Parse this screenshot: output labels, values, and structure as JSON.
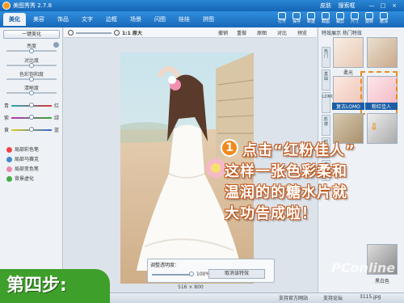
{
  "app": {
    "title": "美图秀秀 2.7.8",
    "window_controls": [
      "皮肤",
      "搜索框",
      "—",
      "□",
      "×"
    ]
  },
  "tabs": [
    "美化",
    "美容",
    "饰品",
    "文字",
    "边框",
    "场景",
    "闪图",
    "娃娃",
    "拼图"
  ],
  "active_tab": "美化",
  "toolbar_right": [
    "打开",
    "保存",
    "新建",
    "截图",
    "裁剪",
    "尺寸",
    "旋转",
    "撤消"
  ],
  "toolbar2": {
    "zoom_label": "1:1 原大",
    "items": [
      "撤销",
      "重做",
      "原图",
      "对比",
      "预览"
    ]
  },
  "left": {
    "auto_button": "一键美化",
    "sliders": [
      "亮度",
      "对比度",
      "色彩饱和度",
      "清晰度"
    ],
    "color_bars": [
      {
        "left": "青",
        "right": "红"
      },
      {
        "left": "紫",
        "right": "绿"
      },
      {
        "left": "黄",
        "right": "蓝"
      }
    ],
    "effects": [
      "局部彩色笔",
      "局部马赛克",
      "局部变色笔",
      "背景虚化"
    ]
  },
  "right": {
    "tabs_label": "特效展示 热门特效",
    "vtabs": [
      "热门",
      "基础",
      "LOMO",
      "影楼",
      "时尚",
      "艺术"
    ],
    "thumbs": [
      "柔光",
      "粉红佳人",
      "复古LOMO",
      "黑白色"
    ]
  },
  "opacity": {
    "label": "调整透明度：",
    "value": "100%",
    "button": "取消该特效"
  },
  "image_size": "516 × 800",
  "status": {
    "items": [
      "支持官方网站",
      "支持论坛",
      "3115.jpg"
    ]
  },
  "overlay": {
    "number": "1",
    "lines": [
      "点击“红粉佳人”",
      "这样一张色彩柔和",
      "温润的的糖水片就",
      "大功告成啦！"
    ]
  },
  "step_label": "第四步:",
  "watermark": "PConline",
  "colors": {
    "accent": "#1a68b8",
    "orange": "#f08a1d",
    "green": "#3e9f2a"
  }
}
